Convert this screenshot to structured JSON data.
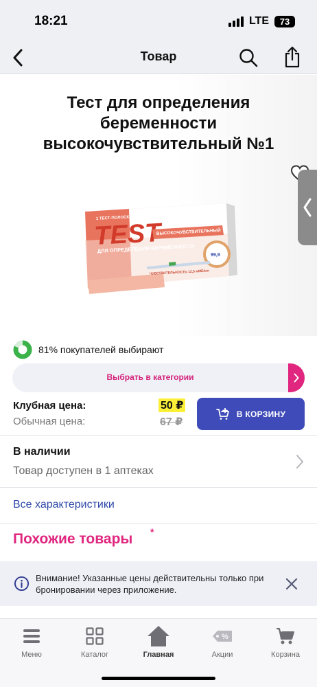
{
  "status_bar": {
    "time": "18:21",
    "network": "LTE",
    "battery": "73"
  },
  "nav": {
    "title": "Товар"
  },
  "product": {
    "title": "Тест для определения беременности высокочувствительный №1",
    "box": {
      "tag": "1 ТЕСТ-ПОЛОСКА",
      "brand": "TEST",
      "subtitle": "ДЛЯ ОПРЕДЕЛЕНИЯ БЕРЕМЕННОСТИ",
      "badge": "ВЫСОКОЧУВСТВИТЕЛЬНЫЙ",
      "accuracy": "99,9",
      "sensitivity": "ЧУВСТВИТЕЛЬНОСТЬ 12,5 мМЕ/мл"
    },
    "popularity_text": "81% покупателей выбирают",
    "popularity_percent": 81,
    "category_button": "Выбрать в категории"
  },
  "price": {
    "club_label": "Клубная цена:",
    "club_value": "50 ₽",
    "regular_label": "Обычная цена:",
    "regular_value": "67 ₽",
    "cart_button": "В КОРЗИНУ"
  },
  "availability": {
    "title": "В наличии",
    "subtitle": "Товар доступен в 1 аптеках"
  },
  "all_specs_link": "Все характеристики",
  "similar": {
    "title": "Похожие товары",
    "marker": "*"
  },
  "notice": {
    "text": "Внимание! Указанные цены действительны только при бронировании через приложение."
  },
  "tabs": [
    {
      "label": "Меню",
      "icon": "menu-icon"
    },
    {
      "label": "Каталог",
      "icon": "catalog-icon"
    },
    {
      "label": "Главная",
      "icon": "home-icon"
    },
    {
      "label": "Акции",
      "icon": "promo-tag-icon"
    },
    {
      "label": "Корзина",
      "icon": "cart-icon"
    }
  ],
  "colors": {
    "accent_pink": "#e0267f",
    "primary_blue": "#3e4bb8",
    "price_highlight": "#fbef38",
    "link_blue": "#2f48a8",
    "popularity_green": "#3bb24a"
  }
}
